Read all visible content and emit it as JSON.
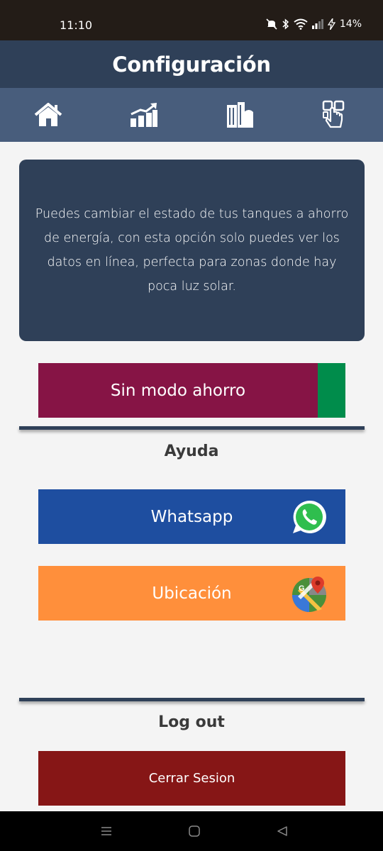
{
  "status_bar": {
    "time": "11:10",
    "battery": "14%",
    "icons": [
      "mute-icon",
      "bluetooth-icon",
      "wifi-icon",
      "signal-icon",
      "charging-icon"
    ]
  },
  "header": {
    "title": "Configuración"
  },
  "nav": {
    "items": [
      {
        "icon": "home-icon"
      },
      {
        "icon": "chart-icon"
      },
      {
        "icon": "tanks-icon"
      },
      {
        "icon": "touch-icon"
      }
    ]
  },
  "info": {
    "text": "Puedes cambiar el estado de tus tanques a ahorro de energía, con esta opción solo puedes ver los datos en línea, perfecta para zonas donde hay poca luz solar."
  },
  "mode_button": {
    "label": "Sin modo ahorro",
    "color": "#861445",
    "toggle_color": "#008c4b"
  },
  "help": {
    "heading": "Ayuda",
    "whatsapp_label": "Whatsapp",
    "location_label": "Ubicación"
  },
  "logout": {
    "heading": "Log out",
    "button_label": "Cerrar Sesion"
  },
  "colors": {
    "primary": "#2f4058",
    "nav": "#485d7c",
    "whatsapp": "#1e4ea0",
    "location": "#ff8f3b",
    "logout": "#861616"
  }
}
